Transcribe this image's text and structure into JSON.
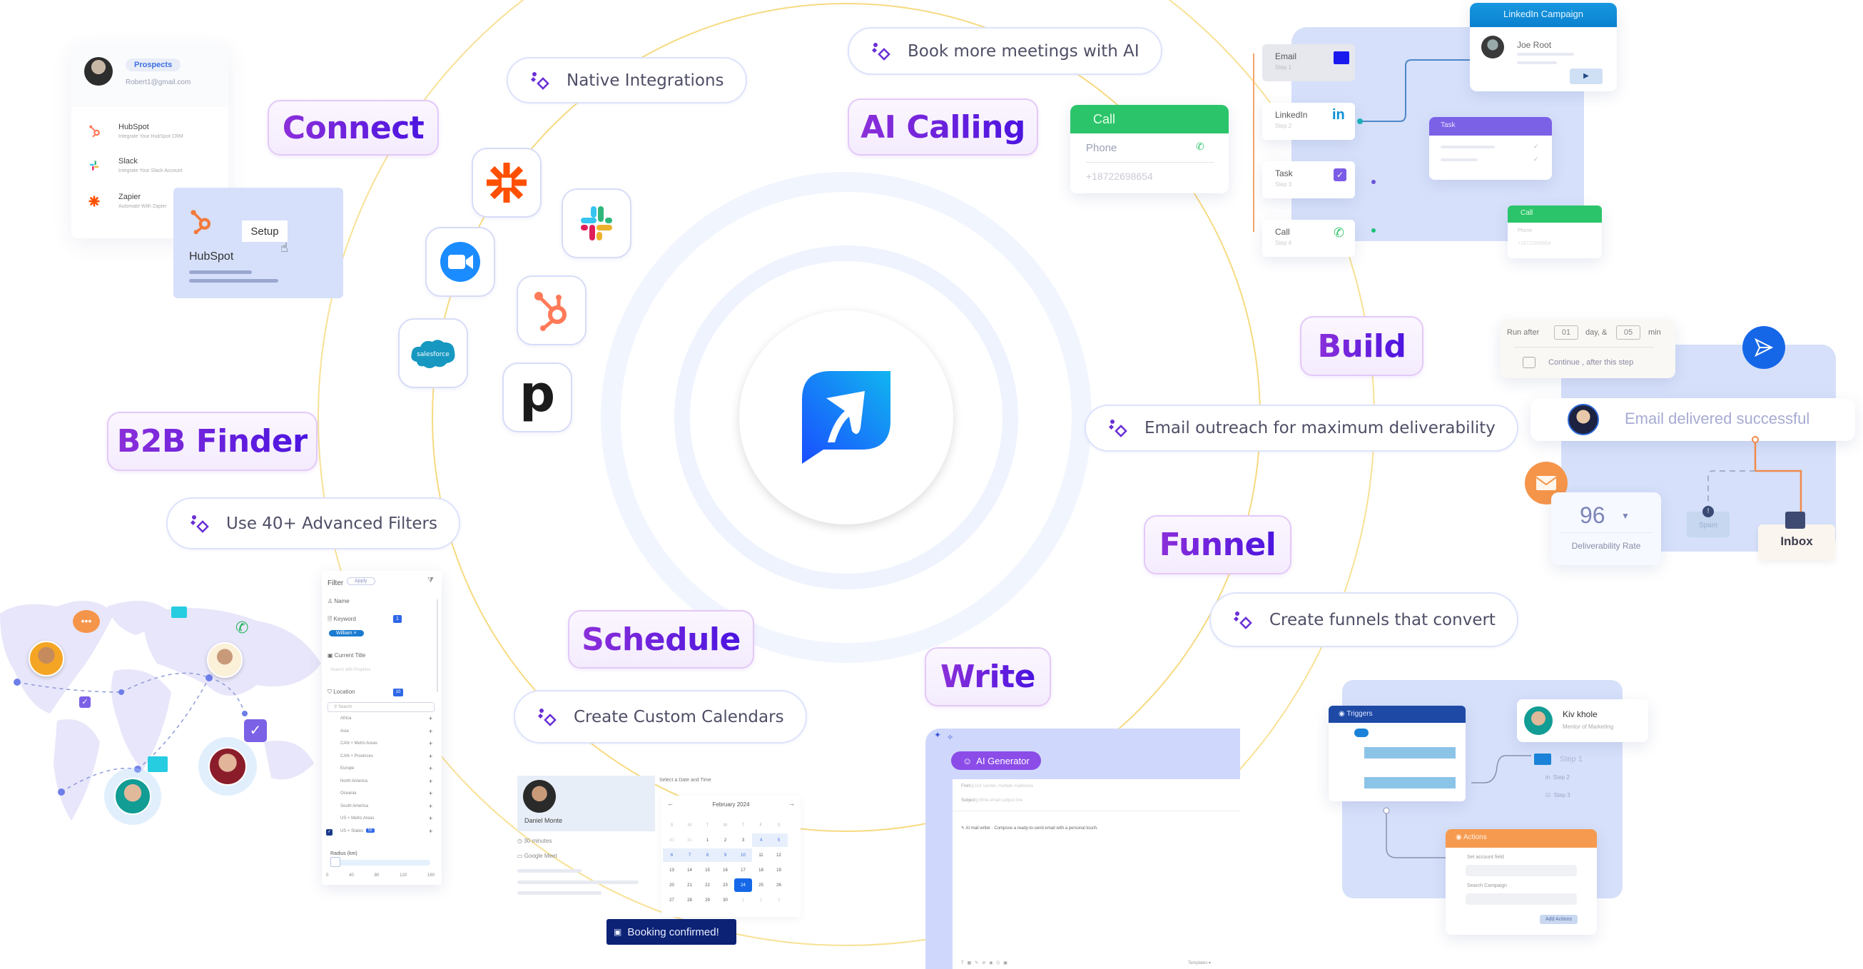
{
  "center": {
    "logo": "brand-logo-icon"
  },
  "features": {
    "connect": "Connect",
    "ai_calling": "AI Calling",
    "build": "Build",
    "b2b_finder": "B2B Finder",
    "funnel": "Funnel",
    "schedule": "Schedule",
    "write": "Write"
  },
  "pills": {
    "native_integrations": "Native Integrations",
    "book_meetings": "Book more meetings with AI",
    "email_outreach": "Email outreach for maximum deliverability",
    "advanced_filters": "Use 40+ Advanced Filters",
    "create_funnels": "Create funnels that convert",
    "custom_calendars": "Create Custom Calendars"
  },
  "integrations": [
    "zapier-icon",
    "zoom-icon",
    "salesforce-icon",
    "slack-icon",
    "hubspot-icon",
    "pipedrive-icon"
  ],
  "integrations_labels": {
    "salesforce": "salesforce",
    "pipedrive": "p"
  },
  "connect_panel": {
    "badge": "Prospects",
    "email": "Robert1@gmail.com",
    "items": [
      {
        "name": "HubSpot",
        "desc": "Integrate Your HubSpot CRM"
      },
      {
        "name": "Slack",
        "desc": "Integrate Your Slack Account"
      },
      {
        "name": "Zapier",
        "desc": "Automate With Zapier"
      }
    ],
    "hubspot_card": {
      "name": "HubSpot",
      "button": "Setup"
    }
  },
  "call_card": {
    "title": "Call",
    "field_label": "Phone",
    "phone": "+18722698654"
  },
  "linkedin_workflow": {
    "steps": [
      {
        "label": "Email",
        "sub": "Step 1"
      },
      {
        "label": "LinkedIn",
        "sub": "Step 2"
      },
      {
        "label": "Task",
        "sub": "Step 3"
      },
      {
        "label": "Call",
        "sub": "Step 4"
      }
    ],
    "campaign_title": "LinkedIn Campaign",
    "contact_name": "Joe Root",
    "task_title": "Task",
    "mini_call": {
      "title": "Call",
      "field_label": "Phone",
      "phone": "+18722698654"
    }
  },
  "deliverability": {
    "run_after_label": "Run after",
    "days_value": "01",
    "days_label": "day, &",
    "min_value": "05",
    "min_label": "min",
    "continue_label": "Continue , after this step",
    "delivered_text": "Email delivered successful",
    "rate_value": "96",
    "rate_label": "Deliverability Rate",
    "spam_label": "Spam",
    "inbox_label": "Inbox"
  },
  "filter_panel": {
    "title": "Filter",
    "apply": "Apply",
    "sections": [
      {
        "label": "Name"
      },
      {
        "label": "Keyword",
        "count": "1"
      },
      {
        "label": "Current Title"
      },
      {
        "label": "Location",
        "count": "10"
      }
    ],
    "keyword_chip": "William",
    "title_placeholder": "Search with Prophics",
    "search_placeholder": "Search",
    "locations": [
      "Africa",
      "Asia",
      "CAN + Metro Areas",
      "CAN + Provinces",
      "Europe",
      "North America",
      "Oceania",
      "South America",
      "US + Metro Areas",
      "US + States"
    ],
    "us_states_count": "50",
    "radius_label": "Radius (km)",
    "radius_ticks": [
      "0",
      "40",
      "80",
      "120",
      "160"
    ],
    "radius_value_fraction": 0
  },
  "calendar": {
    "host": "Daniel Monte",
    "duration": "30 minutes",
    "platform": "Google Meet",
    "heading": "Select a Date and Time",
    "month": "February 2024",
    "weekdays": [
      "S",
      "M",
      "T",
      "W",
      "T",
      "F",
      "S"
    ],
    "weeks": [
      [
        "30",
        "31",
        "1",
        "2",
        "3",
        "4",
        "5"
      ],
      [
        "6",
        "7",
        "8",
        "9",
        "10",
        "11",
        "12"
      ],
      [
        "13",
        "14",
        "15",
        "16",
        "17",
        "18",
        "19"
      ],
      [
        "20",
        "21",
        "22",
        "23",
        "24",
        "25",
        "26"
      ],
      [
        "27",
        "28",
        "29",
        "30",
        "1",
        "2",
        "3"
      ]
    ],
    "selected": "24",
    "toast": "Booking confirmed!"
  },
  "writer": {
    "badge": "AI Generator",
    "from_label": "From",
    "from_value": "Our sender, multiple mailboxes",
    "subject_label": "Subject",
    "subject_value": "Write email subject line",
    "prompt_label": "AI mail writer",
    "prompt_text": "Compose a ready-to-send email with a personal touch.",
    "templates": "Templates"
  },
  "funnel_flow": {
    "triggers": "Triggers",
    "contact_name": "Kiv khole",
    "contact_role": "Mentor of Marketing",
    "steps": [
      "Step 1",
      "Step 2",
      "Step 3"
    ],
    "actions_title": "Actions",
    "field1": "Set account field",
    "field2": "Search Campaign",
    "button": "Add Actions"
  }
}
